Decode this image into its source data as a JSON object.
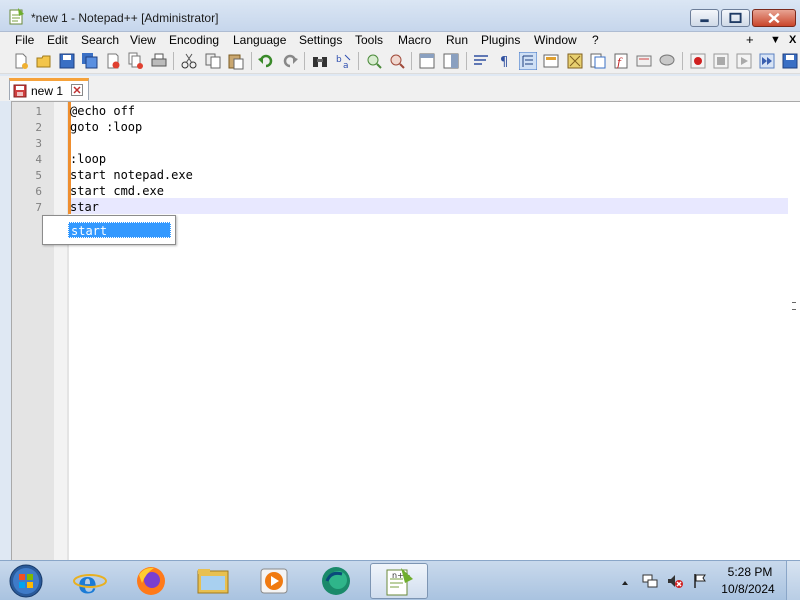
{
  "window": {
    "title": "*new 1 - Notepad++ [Administrator]",
    "app_icon": "notepadpp-icon",
    "controls": [
      "minimize-icon",
      "maximize-icon",
      "close-icon"
    ]
  },
  "menu": {
    "items": [
      "File",
      "Edit",
      "Search",
      "View",
      "Encoding",
      "Language",
      "Settings",
      "Tools",
      "Macro",
      "Run",
      "Plugins",
      "Window",
      "?"
    ],
    "right": [
      "+",
      "▼",
      "X"
    ]
  },
  "toolbar": {
    "icons": [
      "new-icon",
      "open-icon",
      "save-icon",
      "save-all-icon",
      "close-icon",
      "close-all-icon",
      "print-icon",
      "cut-icon",
      "copy-icon",
      "paste-icon",
      "undo-icon",
      "redo-icon",
      "find-icon",
      "replace-icon",
      "zoom-in-icon",
      "zoom-out-icon",
      "sync-vertical-icon",
      "sync-horizontal-icon",
      "word-wrap-icon",
      "show-all-chars-icon",
      "indent-guide-icon",
      "udl-icon",
      "doc-map-icon",
      "function-list-icon",
      "folder-workspace-icon",
      "monitoring-icon",
      "record-macro-icon",
      "stop-macro-icon",
      "play-macro-icon",
      "run-macro-multiple-icon",
      "save-macro-icon"
    ]
  },
  "tabs": [
    {
      "label": "new 1",
      "icon": "save-red-icon",
      "close": "close-icon"
    }
  ],
  "editor": {
    "line_numbers": [
      "1",
      "2",
      "3",
      "4",
      "5",
      "6",
      "7"
    ],
    "lines": [
      "@echo off",
      "goto :loop",
      "",
      ":loop",
      "start notepad.exe",
      "start cmd.exe",
      "star"
    ],
    "current_line": 7,
    "autocomplete": {
      "selected": "start"
    }
  },
  "taskbar": {
    "apps": [
      "start-orb-icon",
      "internet-explorer-icon",
      "firefox-icon",
      "file-explorer-icon",
      "media-player-icon",
      "edge-icon",
      "notepadpp-icon"
    ],
    "active_app": "notepadpp-icon",
    "tray": [
      "show-hidden-icons-icon",
      "network-icon",
      "volume-muted-icon",
      "action-center-flag-icon"
    ],
    "clock": {
      "time": "5:28 PM",
      "date": "10/8/2024"
    }
  },
  "colors": {
    "tab_accent": "#f6a23a",
    "change_marker": "#ef8e2e",
    "current_line": "#e8e8ff",
    "autocomplete_selection": "#3399ff"
  }
}
